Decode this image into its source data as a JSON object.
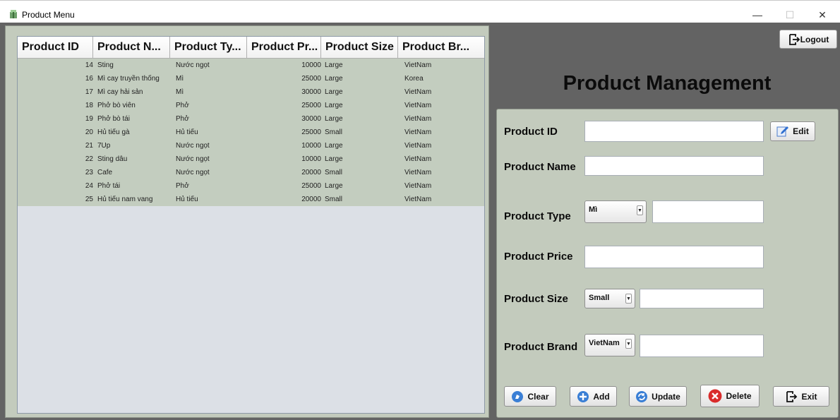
{
  "window": {
    "title": "Product Menu",
    "controls": {
      "minimize": "—",
      "maximize": "☐",
      "close": "✕"
    }
  },
  "header": {
    "logout_label": "Logout",
    "title": "Product Management"
  },
  "table": {
    "columns": [
      "Product ID",
      "Product N...",
      "Product Ty...",
      "Product Pr...",
      "Product Size",
      "Product Br..."
    ],
    "rows": [
      [
        "14",
        "Sting",
        "Nước ngọt",
        "10000",
        "Large",
        "VietNam"
      ],
      [
        "16",
        "Mì cay truyền thống",
        "Mì",
        "25000",
        "Large",
        "Korea"
      ],
      [
        "17",
        "Mì cay hải sản",
        "Mì",
        "30000",
        "Large",
        "VietNam"
      ],
      [
        "18",
        "Phở bò viên",
        "Phở",
        "25000",
        "Large",
        "VietNam"
      ],
      [
        "19",
        "Phở bò tái",
        "Phở",
        "30000",
        "Large",
        "VietNam"
      ],
      [
        "20",
        "Hủ tiếu gà",
        "Hủ tiếu",
        "25000",
        "Small",
        "VietNam"
      ],
      [
        "21",
        "7Up",
        "Nước ngọt",
        "10000",
        "Large",
        "VietNam"
      ],
      [
        "22",
        "Sting dâu",
        "Nước ngọt",
        "10000",
        "Large",
        "VietNam"
      ],
      [
        "23",
        "Cafe",
        "Nước ngọt",
        "20000",
        "Small",
        "VietNam"
      ],
      [
        "24",
        "Phở tái",
        "Phở",
        "25000",
        "Large",
        "VietNam"
      ],
      [
        "25",
        "Hủ tiếu nam vang",
        "Hủ tiếu",
        "20000",
        "Small",
        "VietNam"
      ]
    ]
  },
  "form": {
    "product_id_label": "Product ID",
    "product_id_value": "",
    "edit_label": "Edit",
    "product_name_label": "Product Name",
    "product_name_value": "",
    "product_type_label": "Product Type",
    "product_type_selected": "Mì",
    "product_type_text": "",
    "product_price_label": "Product Price",
    "product_price_value": "",
    "product_size_label": "Product Size",
    "product_size_selected": "Small",
    "product_size_text": "",
    "product_brand_label": "Product Brand",
    "product_brand_selected": "VietNam",
    "product_brand_text": ""
  },
  "actions": {
    "clear": "Clear",
    "add": "Add",
    "update": "Update",
    "delete": "Delete",
    "exit": "Exit"
  },
  "colors": {
    "frame": "#636363",
    "panel": "#c3cbbd",
    "table_empty": "#dce0e6",
    "accent_blue": "#3a7fd5",
    "danger_red": "#d92b2b"
  },
  "icons": {
    "app": "package-icon",
    "logout": "logout-icon",
    "edit": "pencil-icon",
    "clear": "clear-icon",
    "add": "plus-circle-icon",
    "update": "refresh-icon",
    "delete": "x-circle-icon",
    "exit": "exit-icon"
  }
}
